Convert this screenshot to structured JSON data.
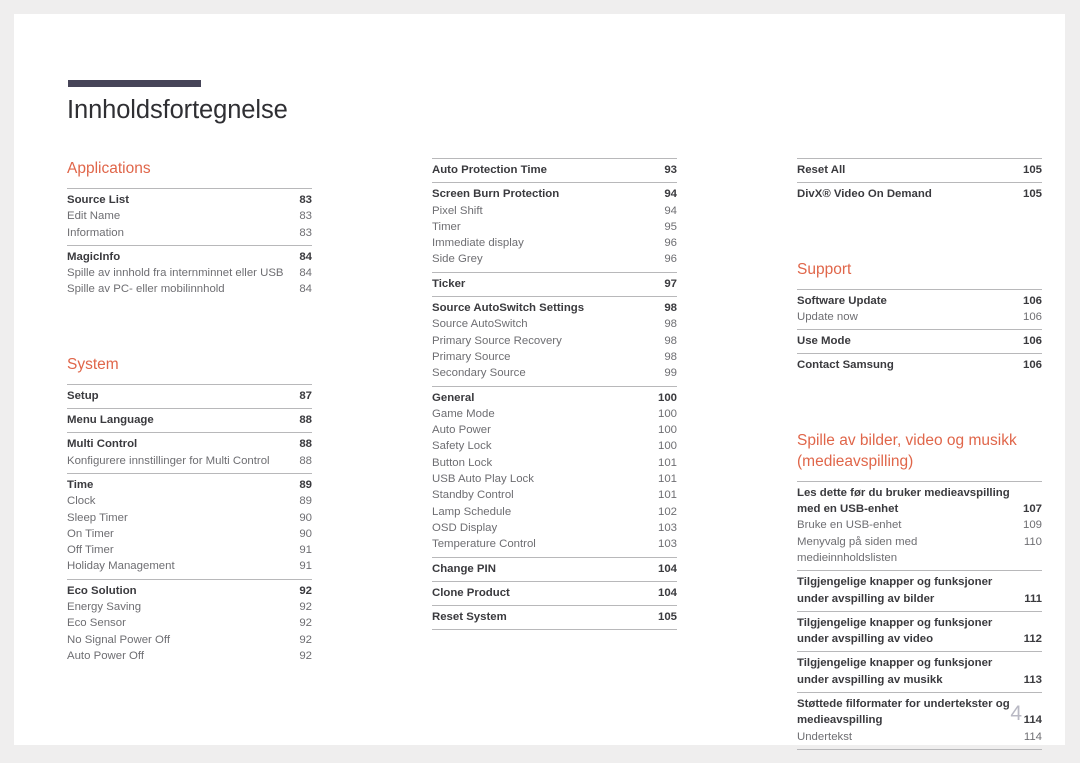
{
  "document": {
    "title": "Innholdsfortegnelse",
    "page_number": "4",
    "accent_color": "#e0664a",
    "rule_color": "#464458"
  },
  "columns": [
    {
      "blocks": [
        {
          "type": "heading",
          "text": "Applications"
        },
        {
          "type": "group",
          "entries": [
            {
              "label": "Source List",
              "page": "83",
              "level": "main"
            },
            {
              "label": "Edit Name",
              "page": "83",
              "level": "sub"
            },
            {
              "label": "Information",
              "page": "83",
              "level": "sub"
            }
          ]
        },
        {
          "type": "group",
          "entries": [
            {
              "label": "MagicInfo",
              "page": "84",
              "level": "main"
            },
            {
              "label": "Spille av innhold fra internminnet eller USB",
              "page": "84",
              "level": "sub"
            },
            {
              "label": "Spille av PC- eller mobilinnhold",
              "page": "84",
              "level": "sub"
            }
          ]
        },
        {
          "type": "heading",
          "text": "System"
        },
        {
          "type": "group",
          "entries": [
            {
              "label": "Setup",
              "page": "87",
              "level": "main"
            }
          ]
        },
        {
          "type": "group",
          "entries": [
            {
              "label": "Menu Language",
              "page": "88",
              "level": "main"
            }
          ]
        },
        {
          "type": "group",
          "entries": [
            {
              "label": "Multi Control",
              "page": "88",
              "level": "main"
            },
            {
              "label": "Konfigurere innstillinger for Multi Control",
              "page": "88",
              "level": "sub"
            }
          ]
        },
        {
          "type": "group",
          "entries": [
            {
              "label": "Time",
              "page": "89",
              "level": "main"
            },
            {
              "label": "Clock",
              "page": "89",
              "level": "sub"
            },
            {
              "label": "Sleep Timer",
              "page": "90",
              "level": "sub"
            },
            {
              "label": "On Timer",
              "page": "90",
              "level": "sub"
            },
            {
              "label": "Off Timer",
              "page": "91",
              "level": "sub"
            },
            {
              "label": "Holiday Management",
              "page": "91",
              "level": "sub"
            }
          ]
        },
        {
          "type": "group",
          "entries": [
            {
              "label": "Eco Solution",
              "page": "92",
              "level": "main"
            },
            {
              "label": "Energy Saving",
              "page": "92",
              "level": "sub"
            },
            {
              "label": "Eco Sensor",
              "page": "92",
              "level": "sub"
            },
            {
              "label": "No Signal Power Off",
              "page": "92",
              "level": "sub"
            },
            {
              "label": "Auto Power Off",
              "page": "92",
              "level": "sub"
            }
          ]
        }
      ]
    },
    {
      "blocks": [
        {
          "type": "group",
          "entries": [
            {
              "label": "Auto Protection Time",
              "page": "93",
              "level": "main"
            }
          ]
        },
        {
          "type": "group",
          "entries": [
            {
              "label": "Screen Burn Protection",
              "page": "94",
              "level": "main"
            },
            {
              "label": "Pixel Shift",
              "page": "94",
              "level": "sub"
            },
            {
              "label": "Timer",
              "page": "95",
              "level": "sub"
            },
            {
              "label": "Immediate display",
              "page": "96",
              "level": "sub"
            },
            {
              "label": "Side Grey",
              "page": "96",
              "level": "sub"
            }
          ]
        },
        {
          "type": "group",
          "entries": [
            {
              "label": "Ticker",
              "page": "97",
              "level": "main"
            }
          ]
        },
        {
          "type": "group",
          "entries": [
            {
              "label": "Source AutoSwitch Settings",
              "page": "98",
              "level": "main"
            },
            {
              "label": "Source AutoSwitch",
              "page": "98",
              "level": "sub"
            },
            {
              "label": "Primary Source Recovery",
              "page": "98",
              "level": "sub"
            },
            {
              "label": "Primary Source",
              "page": "98",
              "level": "sub"
            },
            {
              "label": "Secondary Source",
              "page": "99",
              "level": "sub"
            }
          ]
        },
        {
          "type": "group",
          "entries": [
            {
              "label": "General",
              "page": "100",
              "level": "main"
            },
            {
              "label": "Game Mode",
              "page": "100",
              "level": "sub"
            },
            {
              "label": "Auto Power",
              "page": "100",
              "level": "sub"
            },
            {
              "label": "Safety Lock",
              "page": "100",
              "level": "sub"
            },
            {
              "label": "Button Lock",
              "page": "101",
              "level": "sub"
            },
            {
              "label": "USB Auto Play Lock",
              "page": "101",
              "level": "sub"
            },
            {
              "label": "Standby Control",
              "page": "101",
              "level": "sub"
            },
            {
              "label": "Lamp Schedule",
              "page": "102",
              "level": "sub"
            },
            {
              "label": "OSD Display",
              "page": "103",
              "level": "sub"
            },
            {
              "label": "Temperature Control",
              "page": "103",
              "level": "sub"
            }
          ]
        },
        {
          "type": "group",
          "entries": [
            {
              "label": "Change PIN",
              "page": "104",
              "level": "main"
            }
          ]
        },
        {
          "type": "group",
          "entries": [
            {
              "label": "Clone Product",
              "page": "104",
              "level": "main"
            }
          ]
        },
        {
          "type": "group",
          "last": true,
          "entries": [
            {
              "label": "Reset System",
              "page": "105",
              "level": "main"
            }
          ]
        }
      ]
    },
    {
      "blocks": [
        {
          "type": "group",
          "entries": [
            {
              "label": "Reset All",
              "page": "105",
              "level": "main"
            }
          ]
        },
        {
          "type": "group",
          "entries": [
            {
              "label": "DivX® Video On Demand",
              "page": "105",
              "level": "main"
            }
          ]
        },
        {
          "type": "heading",
          "text": "Support"
        },
        {
          "type": "group",
          "entries": [
            {
              "label": "Software Update",
              "page": "106",
              "level": "main"
            },
            {
              "label": "Update now",
              "page": "106",
              "level": "sub"
            }
          ]
        },
        {
          "type": "group",
          "entries": [
            {
              "label": "Use Mode",
              "page": "106",
              "level": "main"
            }
          ]
        },
        {
          "type": "group",
          "entries": [
            {
              "label": "Contact Samsung",
              "page": "106",
              "level": "main"
            }
          ]
        },
        {
          "type": "heading",
          "text": "Spille av bilder, video og musikk (medieavspilling)"
        },
        {
          "type": "group",
          "entries": [
            {
              "label": "Les dette før du bruker medieavspilling med en USB-enhet",
              "page": "107",
              "level": "main",
              "wrap": true
            },
            {
              "label": "Bruke en USB-enhet",
              "page": "109",
              "level": "sub"
            },
            {
              "label": "Menyvalg på siden med medieinnholdslisten",
              "page": "110",
              "level": "sub"
            }
          ]
        },
        {
          "type": "group",
          "entries": [
            {
              "label": "Tilgjengelige knapper og funksjoner under avspilling av bilder",
              "page": "111",
              "level": "main",
              "wrap": true
            }
          ]
        },
        {
          "type": "group",
          "entries": [
            {
              "label": "Tilgjengelige knapper og funksjoner under avspilling av video",
              "page": "112",
              "level": "main",
              "wrap": true
            }
          ]
        },
        {
          "type": "group",
          "entries": [
            {
              "label": "Tilgjengelige knapper og funksjoner under avspilling av musikk",
              "page": "113",
              "level": "main",
              "wrap": true
            }
          ]
        },
        {
          "type": "group",
          "last": true,
          "entries": [
            {
              "label": "Støttede filformater for undertekster og medieavspilling",
              "page": "114",
              "level": "main",
              "wrap": true
            },
            {
              "label": "Undertekst",
              "page": "114",
              "level": "sub"
            }
          ]
        }
      ]
    }
  ]
}
